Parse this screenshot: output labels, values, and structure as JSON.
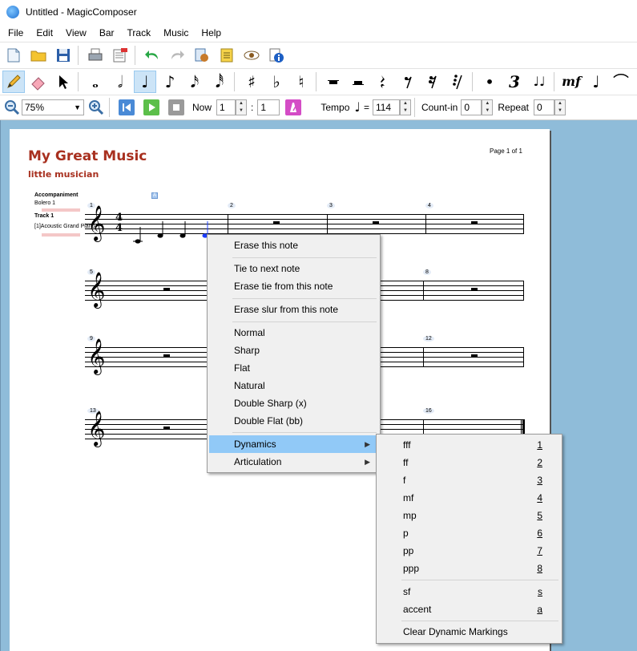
{
  "window": {
    "title": "Untitled - MagicComposer"
  },
  "menubar": [
    "File",
    "Edit",
    "View",
    "Bar",
    "Track",
    "Music",
    "Help"
  ],
  "toolbar1": {
    "icons": [
      "new-document-icon",
      "open-folder-icon",
      "save-icon",
      "print-icon",
      "print-preview-icon",
      "undo-icon",
      "redo-icon",
      "settings-icon",
      "score-properties-icon",
      "view-eye-icon",
      "info-icon"
    ]
  },
  "toolbar2": {
    "glyphs": {
      "whole": "𝅝",
      "half": "𝅗𝅥",
      "quarter": "♩",
      "eighth": "♪",
      "sixteenth": "𝅘𝅥𝅯",
      "thirtysecond": "𝅘𝅥𝅰",
      "sharp": "♯",
      "flat": "♭",
      "natural": "♮",
      "dot": "•",
      "triplet": "3",
      "tie": "♩♩",
      "dynamic": "mf",
      "accent": "♩",
      "slur": "⌒"
    }
  },
  "toolbar3": {
    "zoom": "75%",
    "now_label": "Now",
    "now_bar": "1",
    "now_sep": ":",
    "now_beat": "1",
    "tempo_label": "Tempo",
    "tempo_glyph": "♩",
    "tempo_eq": "=",
    "tempo_value": "114",
    "countin_label": "Count-in",
    "countin_value": "0",
    "repeat_label": "Repeat",
    "repeat_value": "0"
  },
  "score": {
    "title": "My Great Music",
    "author": "little musician",
    "page": "Page 1 of 1",
    "tracks": {
      "accompaniment": "Accompaniment",
      "bolero": "Bolero 1",
      "track1": "Track 1",
      "instrument": "[1]Acoustic Grand Piano"
    },
    "a_badge": "A",
    "time_sig": {
      "top": "4",
      "bottom": "4"
    },
    "bar_numbers": [
      "1",
      "2",
      "3",
      "4",
      "5",
      "8",
      "9",
      "12",
      "13",
      "16"
    ]
  },
  "context_menu": {
    "items": [
      "Erase this note",
      "Tie to next note",
      "Erase tie from this note",
      "Erase slur from this note",
      "Normal",
      "Sharp",
      "Flat",
      "Natural",
      "Double Sharp (x)",
      "Double Flat (bb)",
      "Dynamics",
      "Articulation"
    ],
    "highlighted": "Dynamics"
  },
  "dynamics_menu": {
    "items": [
      {
        "label": "fff",
        "key": "1"
      },
      {
        "label": "ff",
        "key": "2"
      },
      {
        "label": "f",
        "key": "3"
      },
      {
        "label": "mf",
        "key": "4"
      },
      {
        "label": "mp",
        "key": "5"
      },
      {
        "label": "p",
        "key": "6"
      },
      {
        "label": "pp",
        "key": "7"
      },
      {
        "label": "ppp",
        "key": "8"
      },
      {
        "label": "sf",
        "key": "s"
      },
      {
        "label": "accent",
        "key": "a"
      },
      {
        "label": "Clear Dynamic Markings",
        "key": ""
      }
    ]
  },
  "colors": {
    "title_red": "#a8301f",
    "canvas_bg": "#8fbcd9",
    "highlight": "#91c9f7",
    "selected_note": "#1c3cff"
  }
}
